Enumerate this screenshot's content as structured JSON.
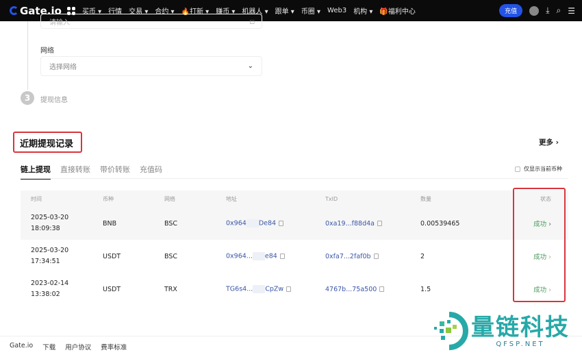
{
  "nav": {
    "logo": "Gate.io",
    "items": [
      "买币 ▾",
      "行情",
      "交易 ▾",
      "合约 ▾",
      "🔥打新 ▾",
      "赚币 ▾",
      "机器人 ▾",
      "跟单 ▾",
      "币圈 ▾",
      "Web3",
      "机构 ▾",
      "🎁福利中心"
    ],
    "deposit": "充值"
  },
  "form": {
    "address_placeholder": "请输入",
    "network_label": "网络",
    "network_placeholder": "选择网络",
    "step_number": "3",
    "step_label": "提现信息"
  },
  "records": {
    "title": "近期提现记录",
    "more": "更多 ›",
    "tabs": [
      "链上提现",
      "直接转账",
      "带价转账",
      "充值码"
    ],
    "filter_label": "仅显示当前币种",
    "headers": [
      "时间",
      "币种",
      "网络",
      "地址",
      "TxID",
      "数量",
      "状态"
    ],
    "rows": [
      {
        "date": "2025-03-20",
        "time": "18:09:38",
        "coin": "BNB",
        "network": "BSC",
        "addr_a": "0x964",
        "addr_b": "De84",
        "txid": "0xa19...f88d4a",
        "amount": "0.00539465",
        "status": "成功"
      },
      {
        "date": "2025-03-20",
        "time": "17:34:51",
        "coin": "USDT",
        "network": "BSC",
        "addr_a": "0x964...",
        "addr_b": "e84",
        "txid": "0xfa7...2faf0b",
        "amount": "2",
        "status": "成功"
      },
      {
        "date": "2023-02-14",
        "time": "13:38:02",
        "coin": "USDT",
        "network": "TRX",
        "addr_a": "TG6s4...",
        "addr_b": "CpZw",
        "txid": "4767b...75a500",
        "amount": "1.5",
        "status": "成功"
      }
    ]
  },
  "footer": [
    "Gate.io",
    "下载",
    "用户协议",
    "费率标准"
  ],
  "watermark": {
    "text": "量链科技",
    "sub": "QFSP.NET"
  },
  "colors": {
    "accent": "#2354e6",
    "success": "#4a9a5a",
    "highlight": "#d9343c"
  }
}
